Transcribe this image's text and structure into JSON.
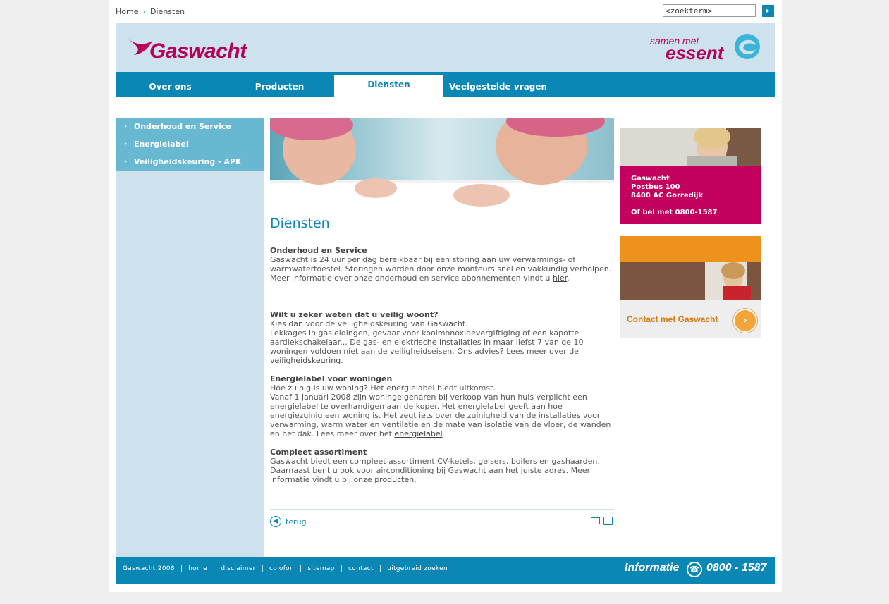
{
  "breadcrumb": {
    "home": "Home",
    "separator": "›",
    "current": "Diensten"
  },
  "search": {
    "value": "<zoekterm>",
    "button_icon": "arrow-right-icon"
  },
  "header": {
    "logo_text": "Gaswacht",
    "partner_small": "samen met",
    "partner_big": "essent"
  },
  "nav": {
    "items": [
      {
        "label": "Over ons"
      },
      {
        "label": "Producten"
      },
      {
        "label": "Diensten"
      },
      {
        "label": "Veelgestelde vragen"
      }
    ],
    "active": "Diensten"
  },
  "sidebar": {
    "items": [
      {
        "label": "Onderhoud en Service"
      },
      {
        "label": "Energielabel"
      },
      {
        "label": "Veiligheidskeuring - APK"
      }
    ]
  },
  "main": {
    "title": "Diensten",
    "sections": [
      {
        "heading": "Onderhoud en Service",
        "text": "Gaswacht is 24 uur per dag bereikbaar bij een storing aan uw verwarmings- of warmwatertoestel. Storingen worden door onze monteurs snel en vakkundig verholpen. Meer informatie over onze onderhoud en service abonnementen vindt u ",
        "link": "hier",
        "after": "."
      },
      {
        "heading": "Wilt u zeker weten dat u veilig woont?",
        "text": "Kies dan voor de veiligheidskeuring van Gaswacht.",
        "text2": "Lekkages in gasleidingen, gevaar voor koolmonoxidevergiftiging of een kapotte aardlekschakelaar... De gas- en elektrische installaties in maar liefst 7 van de 10 woningen voldoen niet aan de veiligheidseisen. Ons advies? Lees meer over de ",
        "link": "veiligheidskeuring",
        "after": "."
      },
      {
        "heading": "Energielabel voor woningen",
        "text": "Hoe zuinig is uw woning? Het energielabel biedt uitkomst.",
        "text2": "Vanaf 1 januari 2008 zijn woningeigenaren bij verkoop van hun huis verplicht een energielabel te overhandigen aan de koper. Het energielabel geeft aan hoe energiezuinig een woning is. Het zegt iets over de zuinigheid van de installaties voor verwarming, warm water en ventilatie en de mate van isolatie van de vloer, de wanden en het dak. Lees meer over het ",
        "link": "energielabel",
        "after": "."
      },
      {
        "heading": "Compleet assortiment",
        "text": "Gaswacht biedt een compleet assortiment CV-ketels, geisers, boilers en gashaarden. Daarnaast bent u ook voor airconditioning bij Gaswacht aan het juiste adres. Meer informatie vindt u bij onze ",
        "link": "producten",
        "after": "."
      }
    ],
    "back_label": "terug",
    "back_icon": "arrow-left-circle-icon",
    "mail_icon": "mail-icon",
    "print_icon": "print-icon"
  },
  "contact_card": {
    "line1": "Gaswacht",
    "line2": "Postbus 100",
    "line3": "8400 AC Gorredijk",
    "line4": "Of bel met 0800-1587"
  },
  "contact_banner": {
    "label": "Contact met Gaswacht",
    "icon": "arrow-right-circle-icon"
  },
  "footer": {
    "links": [
      "Gaswacht 2008",
      "home",
      "disclaimer",
      "colofon",
      "sitemap",
      "contact",
      "uitgebreid zoeken"
    ],
    "info_label": "Informatie",
    "phone": "0800 - 1587",
    "phone_icon": "phone-icon"
  },
  "colors": {
    "brand_blue": "#0a87b5",
    "brand_magenta": "#c3005d",
    "orange": "#ee921d",
    "light_blue": "#cde2ec"
  }
}
